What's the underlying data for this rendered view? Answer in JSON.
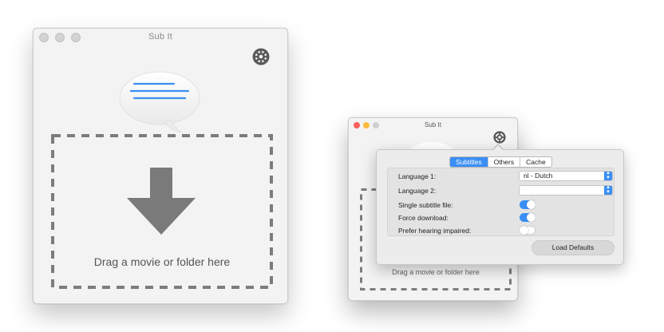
{
  "main_window": {
    "title": "Sub It",
    "drop_label": "Drag a movie or folder here",
    "icons": {
      "gear": "gear-icon",
      "speech_bubble": "speech-bubble-icon",
      "arrow": "down-arrow-icon"
    }
  },
  "small_window": {
    "title": "Sub It",
    "drop_label": "Drag a movie or folder here",
    "traffic_light_colors": [
      "#fc605b",
      "#fdbc40",
      "#cfcfcf"
    ]
  },
  "preferences": {
    "tabs": [
      {
        "label": "Subtitles",
        "active": true
      },
      {
        "label": "Others",
        "active": false
      },
      {
        "label": "Cache",
        "active": false
      }
    ],
    "rows": {
      "language1": {
        "label": "Language 1:",
        "value": "nl - Dutch"
      },
      "language2": {
        "label": "Language 2:",
        "value": ""
      },
      "single_subtitle": {
        "label": "Single subtitle file:",
        "on": true
      },
      "force_download": {
        "label": "Force download:",
        "on": true
      },
      "hearing_impaired": {
        "label": "Prefer hearing impaired:",
        "on": false
      }
    },
    "load_defaults_label": "Load Defaults"
  },
  "colors": {
    "accent": "#3a8ef5",
    "window_bg": "#f3f3f3",
    "dash": "#7c7c7c"
  }
}
